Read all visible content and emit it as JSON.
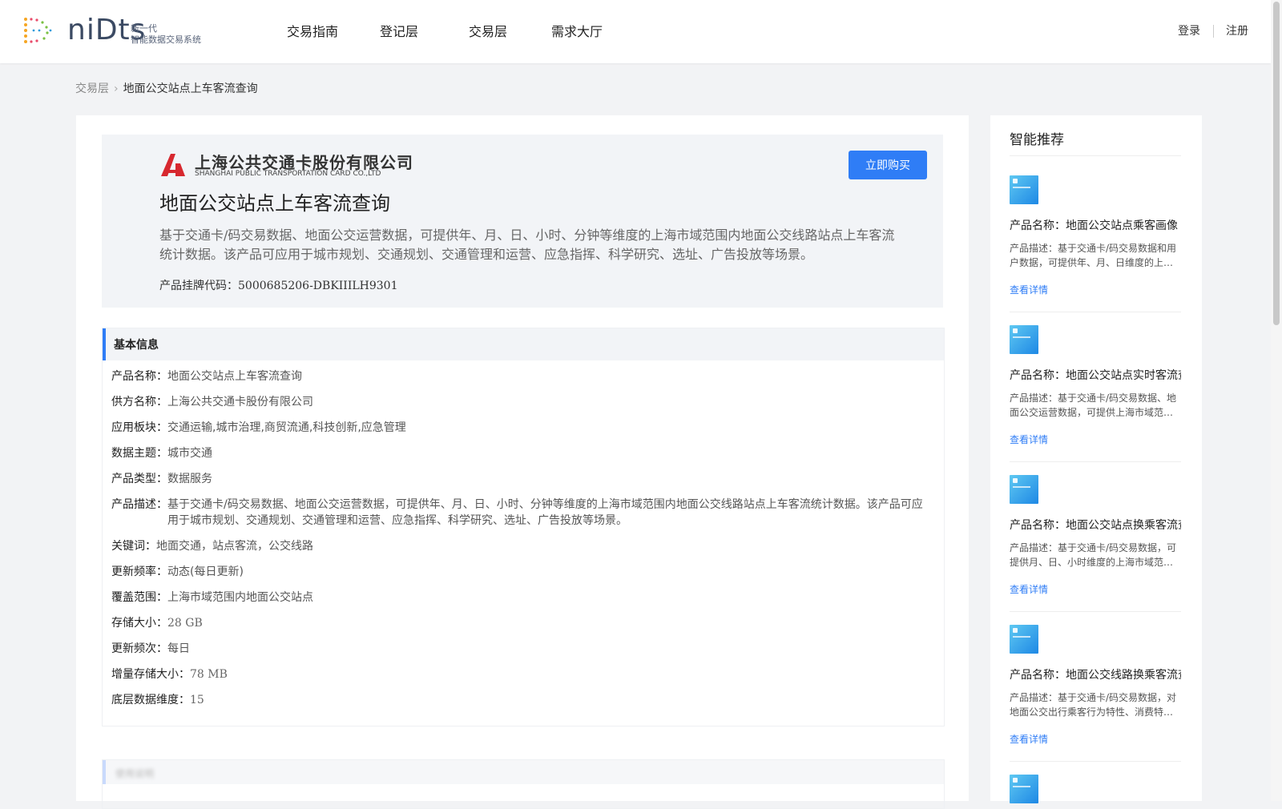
{
  "header": {
    "logo_word": "niDts",
    "logo_sub_line1": "新一代",
    "logo_sub_line2": "智能数据交易系统",
    "nav": [
      "交易指南",
      "登记层",
      "交易层",
      "需求大厅"
    ],
    "login": "登录",
    "register": "注册"
  },
  "breadcrumb": {
    "parent": "交易层",
    "current": "地面公交站点上车客流查询"
  },
  "hero": {
    "company_cn": "上海公共交通卡股份有限公司",
    "company_en": "SHANGHAI PUBLIC TRANSPORTATION CARD CO.,LTD",
    "buy_label": "立即购买",
    "title": "地面公交站点上车客流查询",
    "description": "基于交通卡/码交易数据、地面公交运营数据，可提供年、月、日、小时、分钟等维度的上海市域范围内地面公交线路站点上车客流统计数据。该产品可应用于城市规划、交通规划、交通管理和运营、应急指挥、科学研究、选址、广告投放等场景。",
    "code_label": "产品挂牌代码：",
    "code_value": "5000685206-DBKIIILH9301"
  },
  "basic_info": {
    "heading": "基本信息",
    "rows": [
      {
        "k": "产品名称：",
        "v": "地面公交站点上车客流查询"
      },
      {
        "k": "供方名称：",
        "v": "上海公共交通卡股份有限公司"
      },
      {
        "k": "应用板块：",
        "v": "交通运输,城市治理,商贸流通,科技创新,应急管理"
      },
      {
        "k": "数据主题：",
        "v": "城市交通"
      },
      {
        "k": "产品类型：",
        "v": "数据服务"
      },
      {
        "k": "产品描述：",
        "v": "基于交通卡/码交易数据、地面公交运营数据，可提供年、月、日、小时、分钟等维度的上海市域范围内地面公交线路站点上车客流统计数据。该产品可应用于城市规划、交通规划、交通管理和运营、应急指挥、科学研究、选址、广告投放等场景。"
      },
      {
        "k": "关键词：",
        "v": "地面交通，站点客流，公交线路"
      },
      {
        "k": "更新频率：",
        "v": "动态(每日更新)"
      },
      {
        "k": "覆盖范围：",
        "v": "上海市域范围内地面公交站点"
      },
      {
        "k": "存储大小：",
        "v": "28 GB"
      },
      {
        "k": "更新频次：",
        "v": "每日"
      },
      {
        "k": "增量存储大小：",
        "v": "78 MB"
      },
      {
        "k": "底层数据维度：",
        "v": "15"
      }
    ]
  },
  "section2": {
    "heading": "使用说明"
  },
  "sidebar": {
    "title": "智能推荐",
    "detail_label": "查看详情",
    "items": [
      {
        "name": "产品名称：地面公交站点乘客画像",
        "desc": "产品描述：基于交通卡/码交易数据和用户数据，可提供年、月、日维度的上海市域范围内地面公交站点乘客画像统计数据。"
      },
      {
        "name": "产品名称：地面公交站点实时客流查询",
        "desc": "产品描述：基于交通卡/码交易数据、地面公交运营数据，可提供上海市域范围内地面公交站点实时客流数据。"
      },
      {
        "name": "产品名称：地面公交站点换乘客流查询",
        "desc": "产品描述：基于交通卡/码交易数据，可提供月、日、小时维度的上海市域范围内地面公交站点换乘客流数据。"
      },
      {
        "name": "产品名称：地面公交线路换乘客流查询",
        "desc": "产品描述：基于交通卡/码交易数据，对地面公交出行乘客行为特性、消费特征进行分析。"
      }
    ]
  }
}
